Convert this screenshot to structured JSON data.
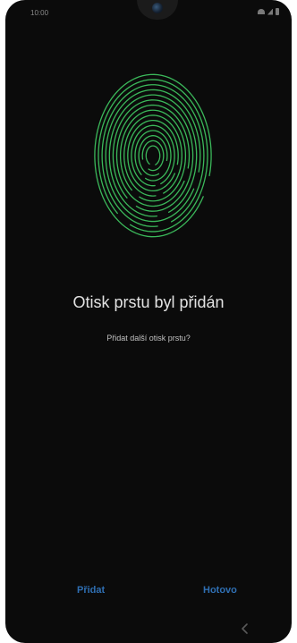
{
  "status_bar": {
    "time": "10:00",
    "icons": [
      "wifi-icon",
      "signal-icon",
      "battery-icon"
    ]
  },
  "screen": {
    "illustration": "fingerprint-icon",
    "title": "Otisk prstu byl přidán",
    "subtitle": "Přidat další otisk prstu?"
  },
  "actions": {
    "add_label": "Přidat",
    "done_label": "Hotovo"
  },
  "nav_bar": {
    "icons": [
      "back-icon"
    ]
  },
  "colors": {
    "background": "#0b0b0b",
    "fingerprint": "#3bb85a",
    "button_text": "#2f6fb3"
  }
}
